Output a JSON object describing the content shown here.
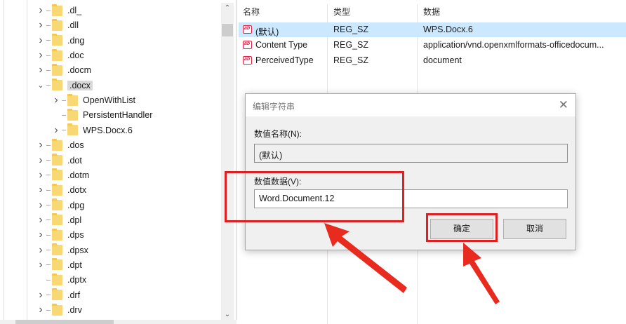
{
  "tree": {
    "items": [
      {
        "label": ".dl_",
        "level": 0,
        "expandable": true
      },
      {
        "label": ".dll",
        "level": 0,
        "expandable": true
      },
      {
        "label": ".dng",
        "level": 0,
        "expandable": true
      },
      {
        "label": ".doc",
        "level": 0,
        "expandable": true
      },
      {
        "label": ".docm",
        "level": 0,
        "expandable": true
      },
      {
        "label": ".docx",
        "level": 0,
        "expandable": true,
        "expanded": true,
        "selected": true
      },
      {
        "label": "OpenWithList",
        "level": 1,
        "expandable": true
      },
      {
        "label": "PersistentHandler",
        "level": 1,
        "expandable": false
      },
      {
        "label": "WPS.Docx.6",
        "level": 1,
        "expandable": true
      },
      {
        "label": ".dos",
        "level": 0,
        "expandable": true
      },
      {
        "label": ".dot",
        "level": 0,
        "expandable": true
      },
      {
        "label": ".dotm",
        "level": 0,
        "expandable": true
      },
      {
        "label": ".dotx",
        "level": 0,
        "expandable": true
      },
      {
        "label": ".dpg",
        "level": 0,
        "expandable": true
      },
      {
        "label": ".dpl",
        "level": 0,
        "expandable": true
      },
      {
        "label": ".dps",
        "level": 0,
        "expandable": true
      },
      {
        "label": ".dpsx",
        "level": 0,
        "expandable": true
      },
      {
        "label": ".dpt",
        "level": 0,
        "expandable": true
      },
      {
        "label": ".dptx",
        "level": 0,
        "expandable": false
      },
      {
        "label": ".drf",
        "level": 0,
        "expandable": true
      },
      {
        "label": ".drv",
        "level": 0,
        "expandable": true
      }
    ]
  },
  "values": {
    "headers": {
      "name": "名称",
      "type": "类型",
      "data": "数据"
    },
    "rows": [
      {
        "name": "(默认)",
        "type": "REG_SZ",
        "data": "WPS.Docx.6"
      },
      {
        "name": "Content Type",
        "type": "REG_SZ",
        "data": "application/vnd.openxmlformats-officedocum..."
      },
      {
        "name": "PerceivedType",
        "type": "REG_SZ",
        "data": "document"
      }
    ]
  },
  "dialog": {
    "title": "编辑字符串",
    "name_label": "数值名称(N):",
    "name_value": "(默认)",
    "data_label": "数值数据(V):",
    "data_value": "Word.Document.12",
    "ok_label": "确定",
    "cancel_label": "取消"
  },
  "annotation_color": "#e02020"
}
